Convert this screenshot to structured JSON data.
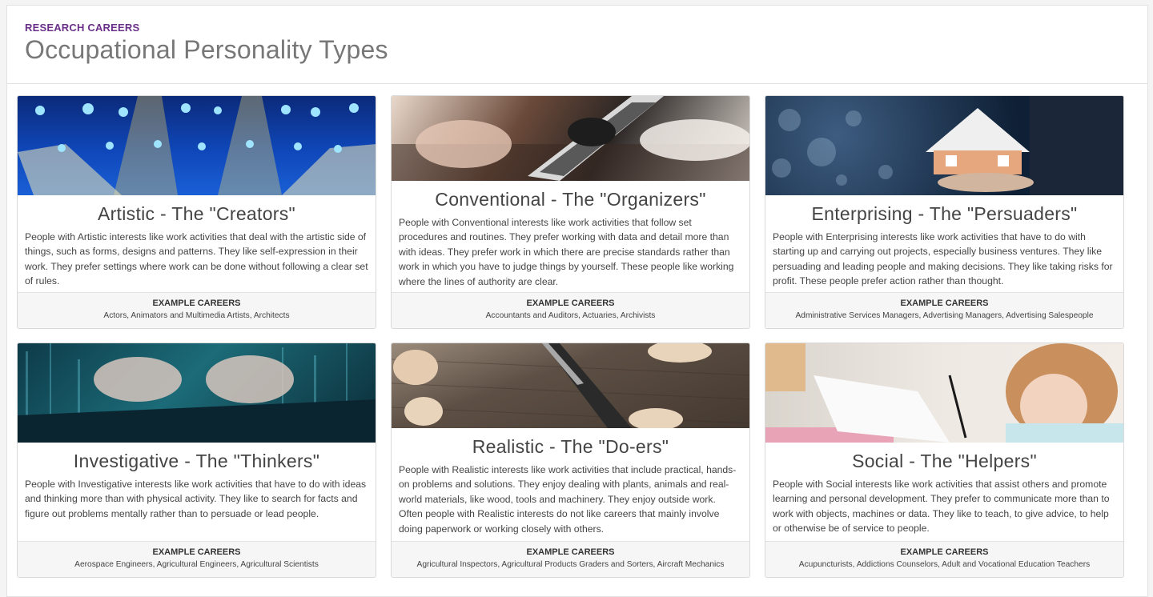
{
  "header": {
    "eyebrow": "RESEARCH CAREERS",
    "title": "Occupational Personality Types"
  },
  "cards": [
    {
      "title": "Artistic - The \"Creators\"",
      "description": "People with Artistic interests like work activities that deal with the artistic side of things, such as forms, designs and patterns. They like self-expression in their work. They prefer settings where work can be done without following a clear set of rules.",
      "examples_label": "EXAMPLE CAREERS",
      "examples": "Actors, Animators and Multimedia Artists, Architects",
      "image": "stage-lights-image"
    },
    {
      "title": "Conventional - The \"Organizers\"",
      "description": "People with Conventional interests like work activities that follow set procedures and routines. They prefer working with data and detail more than with ideas. They prefer work in which there are precise standards rather than work in which you have to judge things by yourself. These people like working where the lines of authority are clear.",
      "examples_label": "EXAMPLE CAREERS",
      "examples": "Accountants and Auditors, Actuaries, Archivists",
      "image": "tablet-meeting-image"
    },
    {
      "title": "Enterprising - The \"Persuaders\"",
      "description": "People with Enterprising interests like work activities that have to do with starting up and carrying out projects, especially business ventures. They like persuading and leading people and making decisions. They like taking risks for profit. These people prefer action rather than thought.",
      "examples_label": "EXAMPLE CAREERS",
      "examples": "Administrative Services Managers, Advertising Managers, Advertising Salespeople",
      "image": "house-model-image"
    },
    {
      "title": "Investigative - The \"Thinkers\"",
      "description": "People with Investigative interests like work activities that have to do with ideas and thinking more than with physical activity. They like to search for facts and figure out problems mentally rather than to persuade or lead people.",
      "examples_label": "EXAMPLE CAREERS",
      "examples": "Aerospace Engineers, Agricultural Engineers, Agricultural Scientists",
      "image": "keyboard-data-image"
    },
    {
      "title": "Realistic - The \"Do-ers\"",
      "description": "People with Realistic interests like work activities that include practical, hands-on problems and solutions. They enjoy dealing with plants, animals and real-world materials, like wood, tools and machinery. They enjoy outside work. Often people with Realistic interests do not like careers that mainly involve doing paperwork or working closely with others.",
      "examples_label": "EXAMPLE CAREERS",
      "examples": "Agricultural Inspectors, Agricultural Products Graders and Sorters, Aircraft Mechanics",
      "image": "woodwork-chisel-image"
    },
    {
      "title": "Social - The \"Helpers\"",
      "description": "People with Social interests like work activities that assist others and promote learning and personal development. They prefer to communicate more than to work with objects, machines or data. They like to teach, to give advice, to help or otherwise be of service to people.",
      "examples_label": "EXAMPLE CAREERS",
      "examples": "Acupuncturists, Addictions Counselors, Adult and Vocational Education Teachers",
      "image": "child-studying-image"
    }
  ],
  "colors": {
    "eyebrow": "#6b2f8a",
    "title": "#777777"
  }
}
